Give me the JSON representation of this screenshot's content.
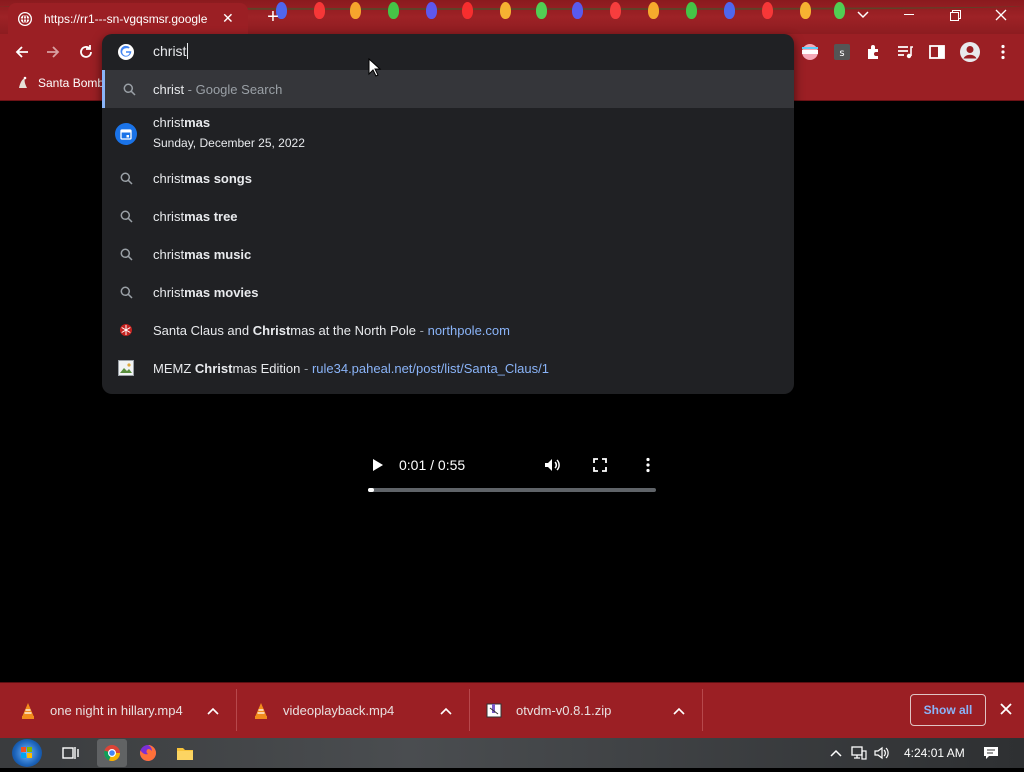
{
  "browser": {
    "tab": {
      "title": "https://rr1---sn-vgqsmsr.google",
      "close_label": "✕"
    },
    "new_tab_label": "+",
    "bookmark": {
      "label": "Santa Bomb"
    }
  },
  "omnibox": {
    "input_value": "christ",
    "suggestions": [
      {
        "type": "search",
        "typed": "christ",
        "suffix": "",
        "note": " - Google Search"
      },
      {
        "type": "calendar",
        "typed": "christ",
        "suffix": "mas",
        "subtitle": "Sunday, December 25, 2022"
      },
      {
        "type": "search",
        "typed": "christ",
        "suffix": "mas songs"
      },
      {
        "type": "search",
        "typed": "christ",
        "suffix": "mas tree"
      },
      {
        "type": "search",
        "typed": "christ",
        "suffix": "mas music"
      },
      {
        "type": "search",
        "typed": "christ",
        "suffix": "mas movies"
      },
      {
        "type": "site",
        "pre": "Santa Claus and ",
        "bold": "Christ",
        "post": "mas at the North Pole",
        "sep": " - ",
        "url": "northpole.com"
      },
      {
        "type": "site",
        "pre": "MEMZ ",
        "bold": "Christ",
        "post": "mas Edition",
        "sep": " - ",
        "url": "rule34.paheal.net/post/list/Santa_Claus/1"
      }
    ]
  },
  "video": {
    "time": "0:01 / 0:55",
    "progress": 0.02
  },
  "downloads": {
    "items": [
      {
        "name": "one night in hillary.mp4",
        "icon": "vlc-icon"
      },
      {
        "name": "videoplayback.mp4",
        "icon": "vlc-icon"
      },
      {
        "name": "otvdm-v0.8.1.zip",
        "icon": "zip-icon"
      }
    ],
    "show_all_label": "Show all"
  },
  "taskbar": {
    "clock": "4:24:01 AM"
  },
  "colors": {
    "chrome_red": "#9b1f24",
    "omnibox_bg": "#202124",
    "link_blue": "#8ab4f8"
  }
}
